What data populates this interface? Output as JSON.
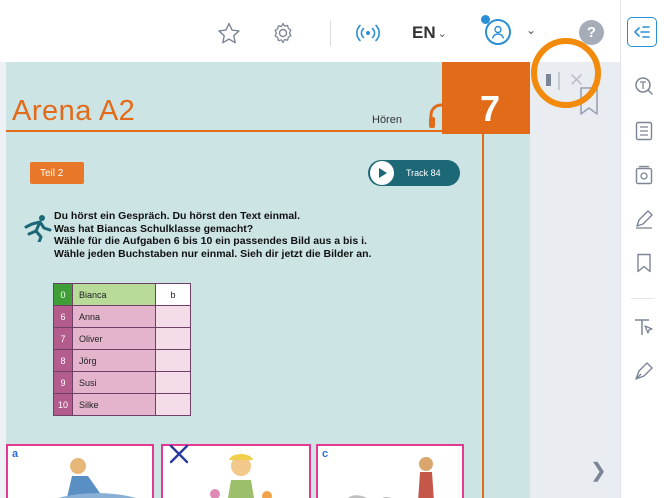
{
  "toolbar": {
    "language": "EN",
    "help_glyph": "?",
    "icons": [
      "star-icon",
      "gear-icon",
      "broadcast-icon",
      "user-icon",
      "help-icon"
    ]
  },
  "book_page": {
    "title": "Arena A2",
    "section_label": "Hören",
    "unit_number": "7",
    "part_label": "Teil 2",
    "track_label": "Track 84",
    "instructions": [
      "Du hörst ein Gespräch. Du hörst den Text einmal.",
      "Was hat Biancas Schulklasse gemacht?",
      "Wähle für die Aufgaben 6 bis 10 ein passendes Bild aus a bis i.",
      "Wähle jeden Buchstaben nur einmal. Sieh dir jetzt die Bilder an."
    ],
    "answer_table": [
      {
        "num": "0",
        "name": "Bianca",
        "answer": "b"
      },
      {
        "num": "6",
        "name": "Anna",
        "answer": ""
      },
      {
        "num": "7",
        "name": "Oliver",
        "answer": ""
      },
      {
        "num": "8",
        "name": "Jörg",
        "answer": ""
      },
      {
        "num": "9",
        "name": "Susi",
        "answer": ""
      },
      {
        "num": "10",
        "name": "Silke",
        "answer": ""
      }
    ],
    "pictures": [
      {
        "letter": "a"
      },
      {
        "letter": ""
      },
      {
        "letter": "c"
      }
    ]
  },
  "colors": {
    "accent": "#2a8fd6",
    "brand_orange": "#e26b1a",
    "highlight_ring": "#f28b0c",
    "page_background": "#cde4e4",
    "track_button": "#1c6877",
    "table_row": "#b45c8c",
    "table_first_row": "#3f9e36"
  },
  "right_rail_icons": [
    "collapse-panel-icon",
    "search-icon",
    "table-of-contents-icon",
    "preview-icon",
    "edit-icon",
    "bookmark-icon",
    "pointer-tool-icon",
    "pen-tool-icon"
  ]
}
